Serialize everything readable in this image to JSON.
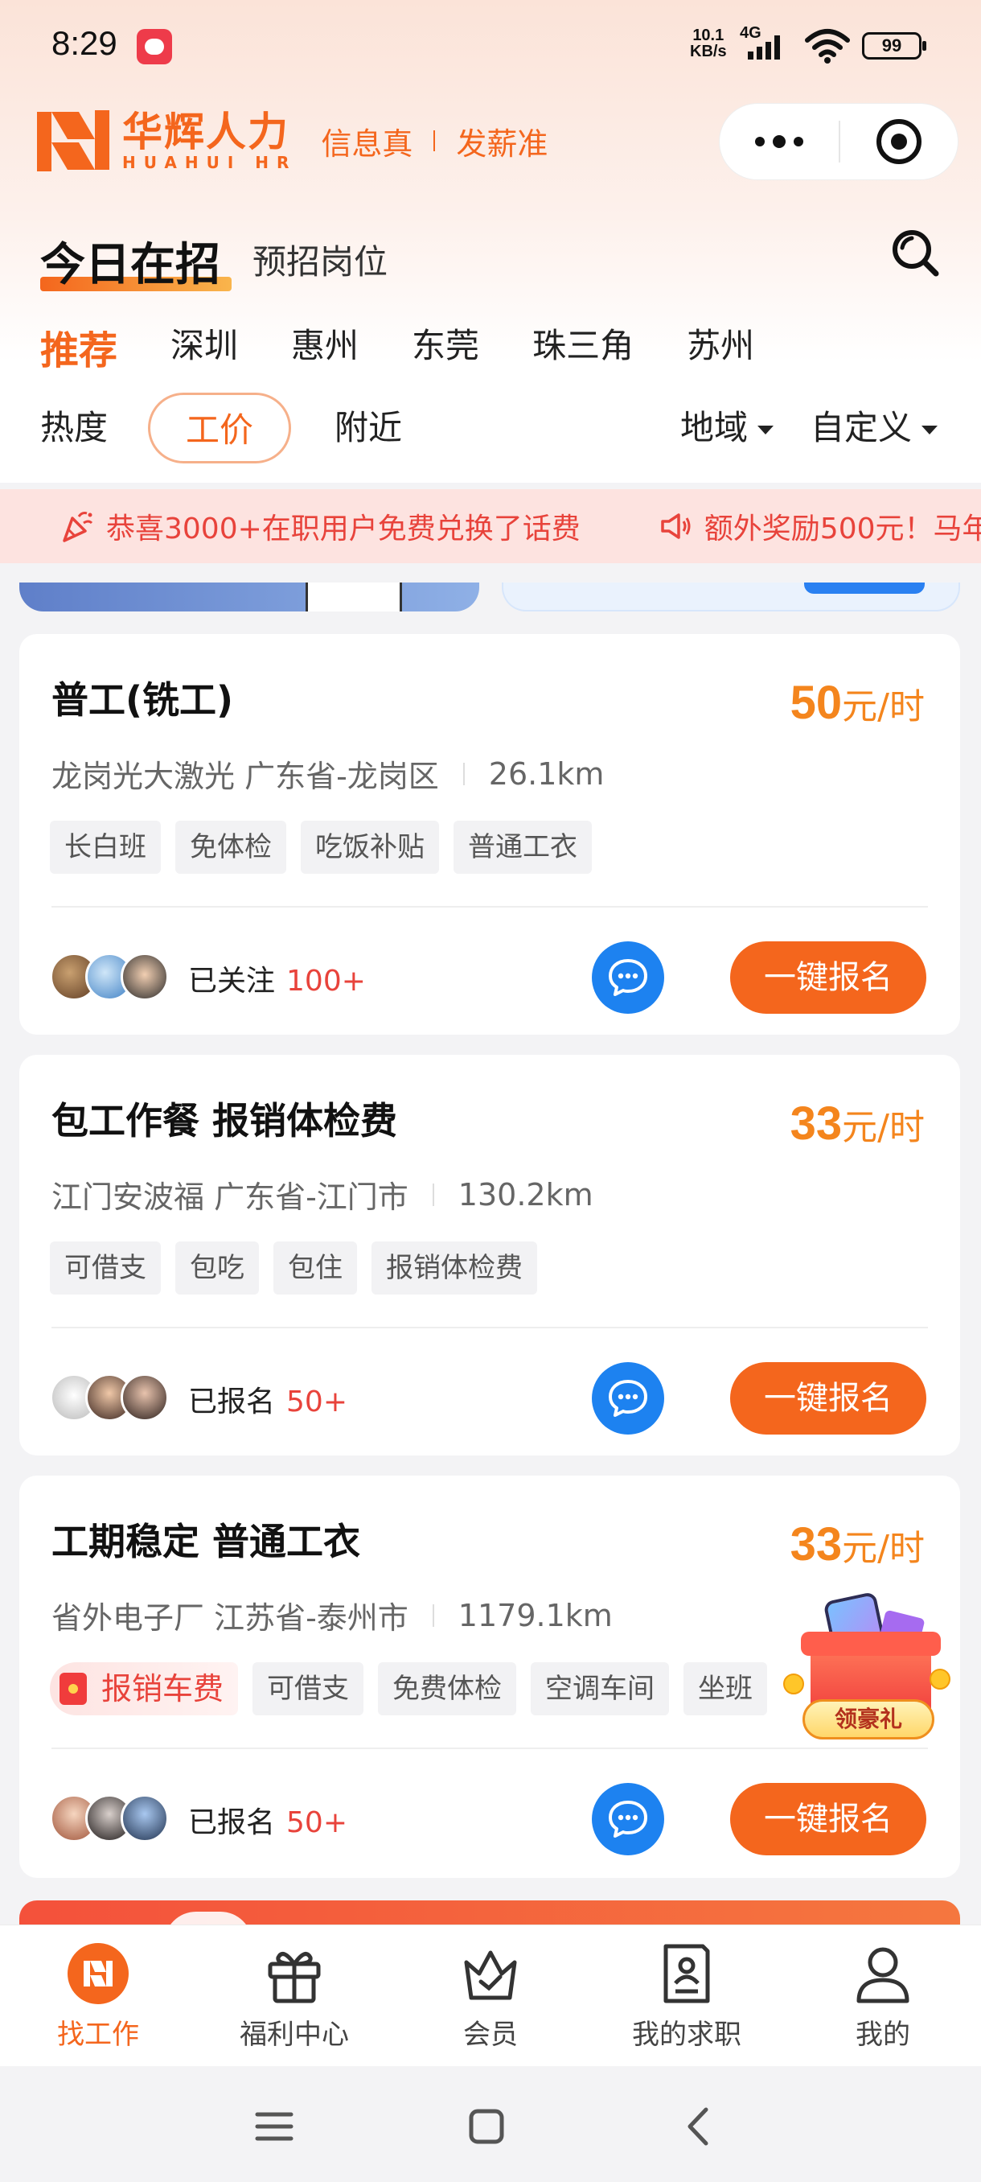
{
  "status_bar": {
    "time": "8:29",
    "net_speed_value": "10.1",
    "net_speed_unit": "KB/s",
    "network": "4G",
    "battery": "99"
  },
  "brand": {
    "name_cn": "华辉人力",
    "name_en": "HUAHUI HR",
    "slogan_left": "信息真",
    "slogan_right": "发薪准",
    "color": "#f4661d"
  },
  "tabs": {
    "main": "今日在招",
    "secondary": "预招岗位"
  },
  "cities": [
    "推荐",
    "深圳",
    "惠州",
    "东莞",
    "珠三角",
    "苏州"
  ],
  "filters": {
    "sort": [
      "热度",
      "工价",
      "附近"
    ],
    "active_sort": "工价",
    "region": "地域",
    "custom": "自定义"
  },
  "notices": [
    "恭喜3000+在职用户免费兑换了话费",
    "额外奖励500元！马年"
  ],
  "jobs": [
    {
      "title": "普工(铣工)",
      "salary_value": "50",
      "salary_unit": "元/时",
      "company_location": "龙岗光大激光 广东省-龙岗区",
      "distance": "26.1km",
      "tags": [
        "长白班",
        "免体检",
        "吃饭补贴",
        "普通工衣"
      ],
      "status_label": "已关注",
      "status_count": "100+",
      "apply_label": "一键报名"
    },
    {
      "title": "包工作餐 报销体检费",
      "salary_value": "33",
      "salary_unit": "元/时",
      "company_location": "江门安波福 广东省-江门市",
      "distance": "130.2km",
      "tags": [
        "可借支",
        "包吃",
        "包住",
        "报销体检费"
      ],
      "status_label": "已报名",
      "status_count": "50+",
      "apply_label": "一键报名"
    },
    {
      "title": "工期稳定 普通工衣",
      "salary_value": "33",
      "salary_unit": "元/时",
      "company_location": "省外电子厂 江苏省-泰州市",
      "distance": "1179.1km",
      "highlight_tag": "报销车费",
      "tags": [
        "可借支",
        "免费体检",
        "空调车间",
        "坐班"
      ],
      "status_label": "已报名",
      "status_count": "50+",
      "apply_label": "一键报名"
    }
  ],
  "gift_badge": "领豪礼",
  "tabbar": [
    {
      "label": "找工作",
      "icon": "logo-icon",
      "active": true
    },
    {
      "label": "福利中心",
      "icon": "gift-icon",
      "active": false
    },
    {
      "label": "会员",
      "icon": "crown-icon",
      "active": false
    },
    {
      "label": "我的求职",
      "icon": "resume-icon",
      "active": false
    },
    {
      "label": "我的",
      "icon": "person-icon",
      "active": false
    }
  ],
  "colors": {
    "accent": "#f4661d",
    "salary": "#f4851d",
    "chat": "#1d82f0",
    "notice_text": "#e8433b"
  }
}
